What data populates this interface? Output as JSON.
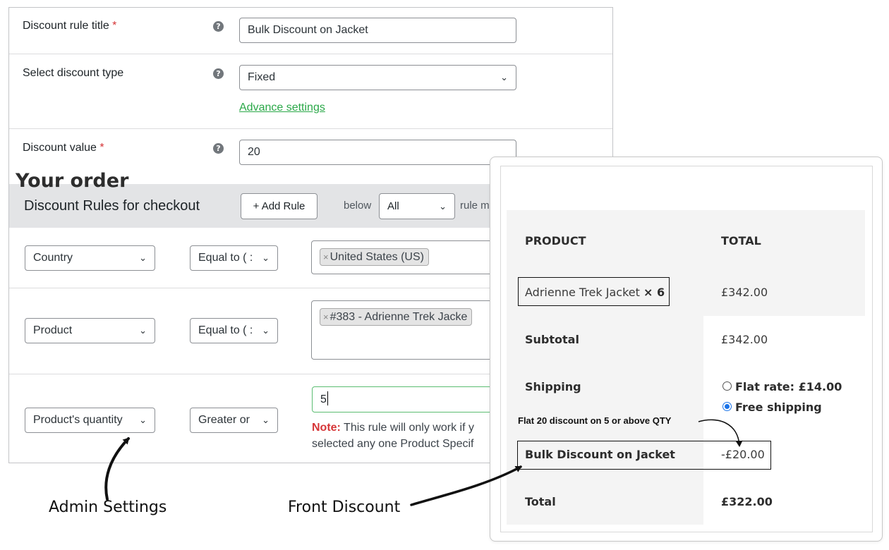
{
  "admin": {
    "title_label": "Discount rule title",
    "title_required": "*",
    "title_value": "Bulk Discount on Jacket",
    "type_label": "Select discount type",
    "type_value": "Fixed",
    "advance_link": "Advance settings",
    "value_label": "Discount value",
    "value_required": "*",
    "value_value": "20",
    "help_glyph": "?"
  },
  "rules": {
    "heading": "Discount Rules for checkout",
    "add_rule": "+ Add Rule",
    "below_text": "below",
    "below_select": "All",
    "rule_m_text": "rule m",
    "rows": [
      {
        "field": "Country",
        "operator": "Equal to ( :",
        "tag": "United States (US)"
      },
      {
        "field": "Product",
        "operator": "Equal to ( :",
        "tag": "#383 - Adrienne Trek Jacke"
      },
      {
        "field": "Product's quantity",
        "operator": "Greater or",
        "value": "5"
      }
    ],
    "note_label": "Note:",
    "note_line1": "This rule will only work if y",
    "note_line2": "selected any one Product Specif",
    "tag_remove": "×"
  },
  "captions": {
    "admin": "Admin Settings",
    "front": "Front Discount",
    "annotation": "Flat 20 discount on 5 or above QTY"
  },
  "order": {
    "title": "Your order",
    "col_product": "PRODUCT",
    "col_total": "TOTAL",
    "item_name": "Adrienne Trek Jacket",
    "item_qty": "× 6",
    "item_total": "£342.00",
    "subtotal_label": "Subtotal",
    "subtotal_value": "£342.00",
    "shipping_label": "Shipping",
    "shipping_options": [
      "Flat rate: £14.00",
      "Free shipping"
    ],
    "shipping_selected": "Free shipping",
    "discount_label": "Bulk Discount on Jacket",
    "discount_value": "-£20.00",
    "total_label": "Total",
    "total_value": "£322.00"
  },
  "colors": {
    "required": "#d63638",
    "link": "#2aa848",
    "radio": "#1a73e8",
    "rules_header_bg": "#e3e4e6"
  },
  "icons": [
    "help-icon",
    "chevron-down-icon",
    "remove-tag-icon",
    "radio-icon"
  ]
}
